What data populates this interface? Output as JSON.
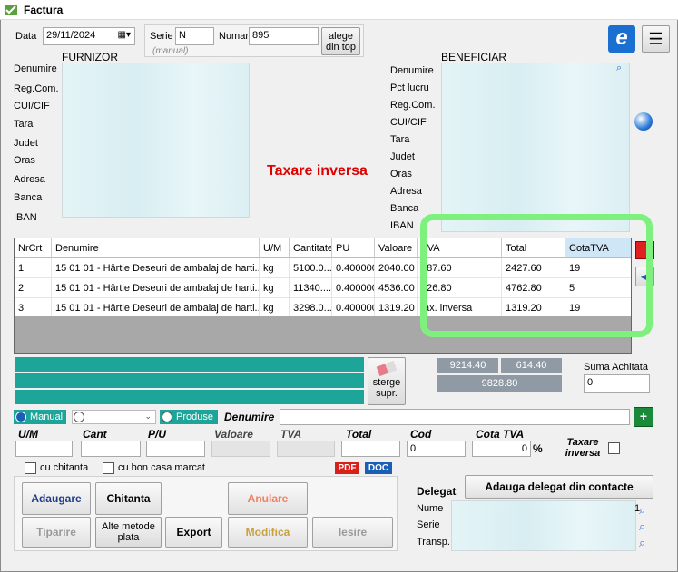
{
  "window": {
    "title": "Factura"
  },
  "header": {
    "data_label": "Data",
    "date_value": "29/11/2024",
    "serie_label": "Serie",
    "serie_value": "N",
    "serie_hint": "(manual)",
    "numar_label": "Numar",
    "numar_value": "895",
    "alege_label": "alege din top"
  },
  "furnizor": {
    "title": "FURNIZOR",
    "labels": [
      "Denumire",
      "Reg.Com.",
      "CUI/CIF",
      "Tara",
      "Judet",
      "Oras",
      "Adresa",
      "Banca",
      "IBAN"
    ]
  },
  "beneficiar": {
    "title": "BENEFICIAR",
    "labels": [
      "Denumire",
      "Pct lucru",
      "Reg.Com.",
      "CUI/CIF",
      "Tara",
      "Judet",
      "Oras",
      "Adresa",
      "Banca",
      "IBAN"
    ]
  },
  "taxare_inversa_text": "Taxare inversa",
  "table": {
    "columns": [
      "NrCrt",
      "Denumire",
      "U/M",
      "Cantitate",
      "PU",
      "Valoare",
      "TVA",
      "Total",
      "CotaTVA"
    ],
    "rows": [
      [
        "1",
        "15 01 01 - Hârtie Deseuri de ambalaj de harti...",
        "kg",
        "5100.0...",
        "0.400000",
        "2040.00",
        "387.60",
        "2427.60",
        "19"
      ],
      [
        "2",
        "15 01 01 - Hârtie Deseuri de ambalaj de harti...",
        "kg",
        "11340....",
        "0.400000",
        "4536.00",
        "226.80",
        "4762.80",
        "5"
      ],
      [
        "3",
        "15 01 01 - Hârtie Deseuri de ambalaj de harti...",
        "kg",
        "3298.0...",
        "0.400000",
        "1319.20",
        "tax. inversa",
        "1319.20",
        "19"
      ]
    ]
  },
  "totals": {
    "valoare": "9214.40",
    "tva": "614.40",
    "total": "9828.80"
  },
  "sterge_label": "sterge supr.",
  "suma_achitata": {
    "label": "Suma Achitata",
    "value": "0"
  },
  "entry": {
    "manual_label": "Manual",
    "produse_label": "Produse",
    "denumire_label": "Denumire",
    "um_label": "U/M",
    "cant_label": "Cant",
    "pu_label": "P/U",
    "valoare_label": "Valoare",
    "tva_label": "TVA",
    "total_label": "Total",
    "cod_label": "Cod",
    "cod_value": "0",
    "cota_tva_label": "Cota TVA",
    "cota_tva_value": "0",
    "percent": "%",
    "taxare_inversa_label": "Taxare inversa"
  },
  "checks": {
    "cu_chitanta": "cu chitanta",
    "cu_bon": "cu bon casa marcat"
  },
  "export": {
    "pdf": "PDF",
    "doc": "DOC"
  },
  "actions": {
    "adaugare": "Adaugare",
    "chitanta": "Chitanta",
    "anulare": "Anulare",
    "tiparire": "Tiparire",
    "alte_metode": "Alte metode plata",
    "export": "Export",
    "modifica": "Modifica",
    "iesire": "Iesire"
  },
  "delegat": {
    "title": "Delegat",
    "add_button": "Adauga delegat din contacte",
    "labels": [
      "Nume",
      "Serie",
      "Transp."
    ],
    "nume_value": "1"
  },
  "colors": {
    "teal": "#1da59a",
    "red_text": "#e00000",
    "highlight": "#7ef07e"
  }
}
